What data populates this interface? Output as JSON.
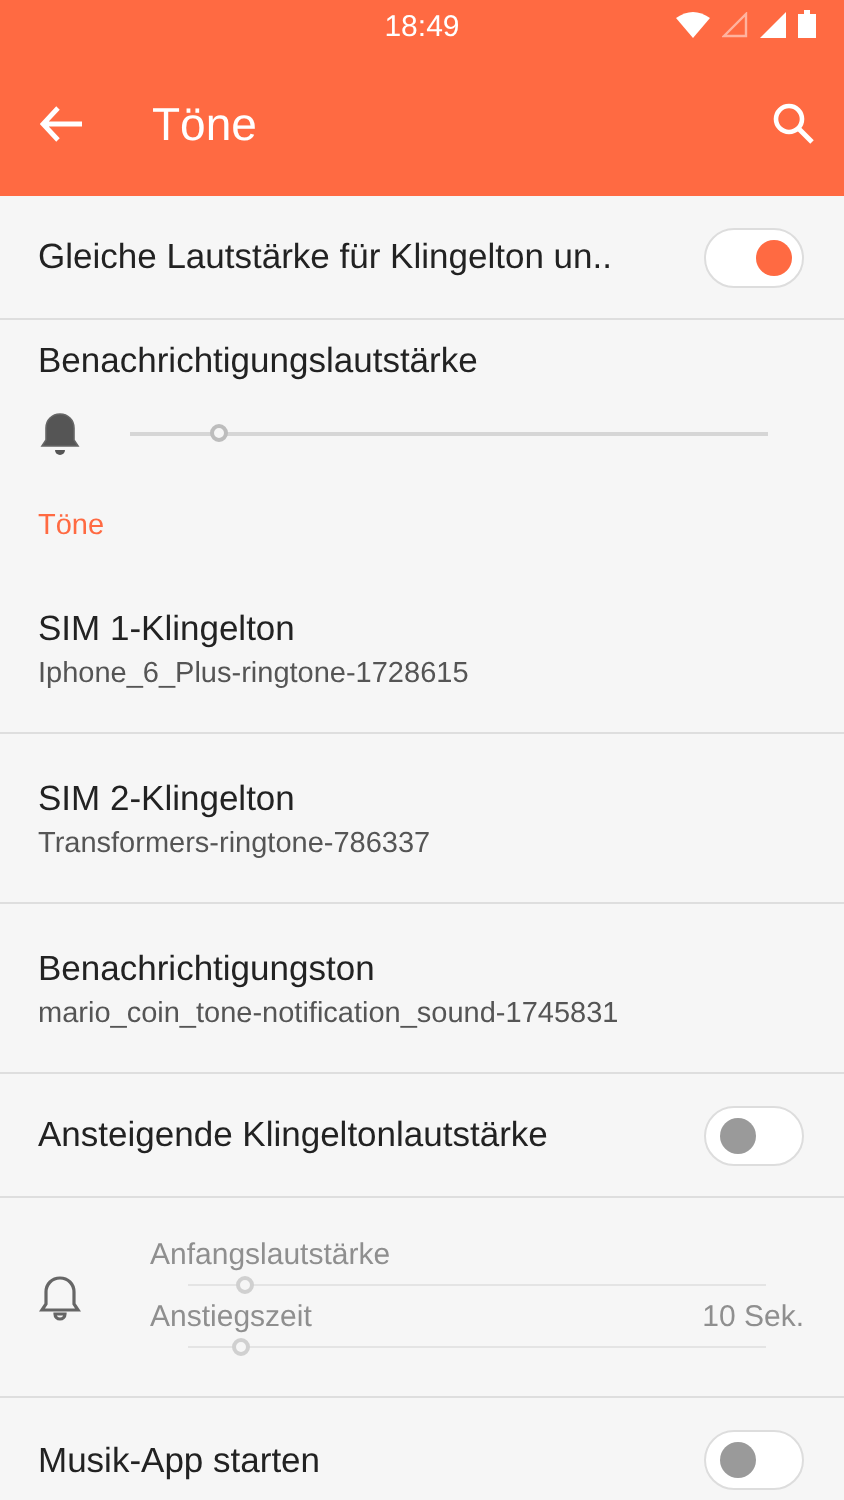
{
  "status_bar": {
    "time": "18:49"
  },
  "app_bar": {
    "title": "Töne"
  },
  "items": [
    {
      "kind": "switch",
      "title": "Gleiche Lautstärke für Klingelton un..",
      "on": true
    },
    {
      "kind": "slider",
      "title": "Benachrichtigungslautstärke",
      "level": 0.14
    },
    {
      "kind": "header",
      "title": "Töne"
    },
    {
      "kind": "tone",
      "title": "SIM 1-Klingelton",
      "subtitle": "Iphone_6_Plus-ringtone-1728615"
    },
    {
      "kind": "tone",
      "title": "SIM 2-Klingelton",
      "subtitle": "Transformers-ringtone-786337"
    },
    {
      "kind": "tone",
      "title": "Benachrichtigungston",
      "subtitle": "mario_coin_tone-notification_sound-1745831"
    },
    {
      "kind": "switch",
      "title": "Ansteigende Klingeltonlautstärke",
      "on": false
    },
    {
      "kind": "ramp",
      "disabled": true,
      "sliders": [
        {
          "label": "Anfangslautstärke",
          "level": 0.1
        },
        {
          "label": "Anstiegszeit",
          "reading": "10 Sek.",
          "level": 0.09
        }
      ]
    },
    {
      "kind": "switch",
      "title": "Musik-App starten",
      "on": false
    }
  ]
}
